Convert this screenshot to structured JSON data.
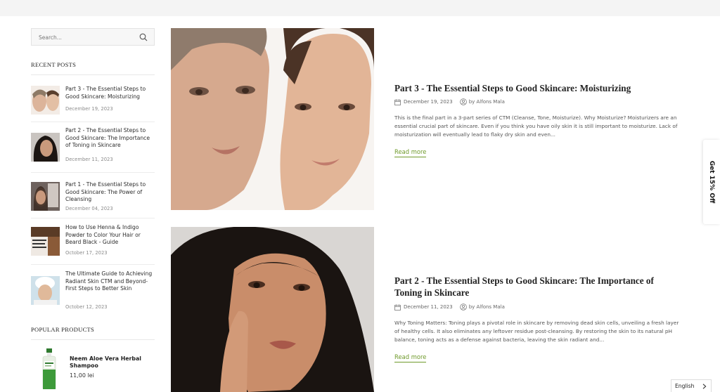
{
  "search": {
    "placeholder": "Search..."
  },
  "recent_posts": {
    "title": "RECENT POSTS",
    "items": [
      {
        "title": "Part 3 - The Essential Steps to Good Skincare: Moisturizing",
        "date": "December 19, 2023"
      },
      {
        "title": "Part 2 - The Essential Steps to Good Skincare: The Importance of Toning in Skincare",
        "date": "December 11, 2023"
      },
      {
        "title": "Part 1 - The Essential Steps to Good Skincare: The Power of Cleansing",
        "date": "December 04, 2023"
      },
      {
        "title": "How to Use Henna & Indigo Powder to Color Your Hair or Beard Black - Guide",
        "date": "October 17, 2023"
      },
      {
        "title": "The Ultimate Guide to Achieving Radiant Skin CTM and Beyond-First Steps to Better Skin",
        "date": "October 12, 2023"
      }
    ]
  },
  "popular_products": {
    "title": "POPULAR PRODUCTS",
    "items": [
      {
        "name": "Neem Aloe Vera Herbal Shampoo",
        "price": "11,00 lei"
      }
    ]
  },
  "articles": [
    {
      "title": "Part 3 - The Essential Steps to Good Skincare: Moisturizing",
      "date": "December 19, 2023",
      "author": "by Alfons Mala",
      "excerpt": "This is the final part in a 3-part series of CTM (Cleanse, Tone, Moisturize). Why Moisturize? Moisturizers are an essential crucial part of skincare. Even if you think you have oily skin it is still important to moisturize. Lack of moisturization will eventually lead to flaky dry skin and even...",
      "read_more": "Read more"
    },
    {
      "title": "Part 2 - The Essential Steps to Good Skincare: The Importance of Toning in Skincare",
      "date": "December 11, 2023",
      "author": "by Alfons Mala",
      "excerpt": "Why Toning Matters: Toning plays a pivotal role in skincare by removing dead skin cells, unveiling a fresh layer of healthy cells. It also eliminates any leftover residue post-cleansing. By restoring the skin to its natural pH balance, toning acts as a defense against bacteria, leaving the skin radiant and...",
      "read_more": "Read more"
    }
  ],
  "offer_tab": {
    "label": "Get 15% Off"
  },
  "language": {
    "label": "English"
  },
  "colors": {
    "accent": "#6f9a2b",
    "topbar": "#f4f4f4"
  }
}
